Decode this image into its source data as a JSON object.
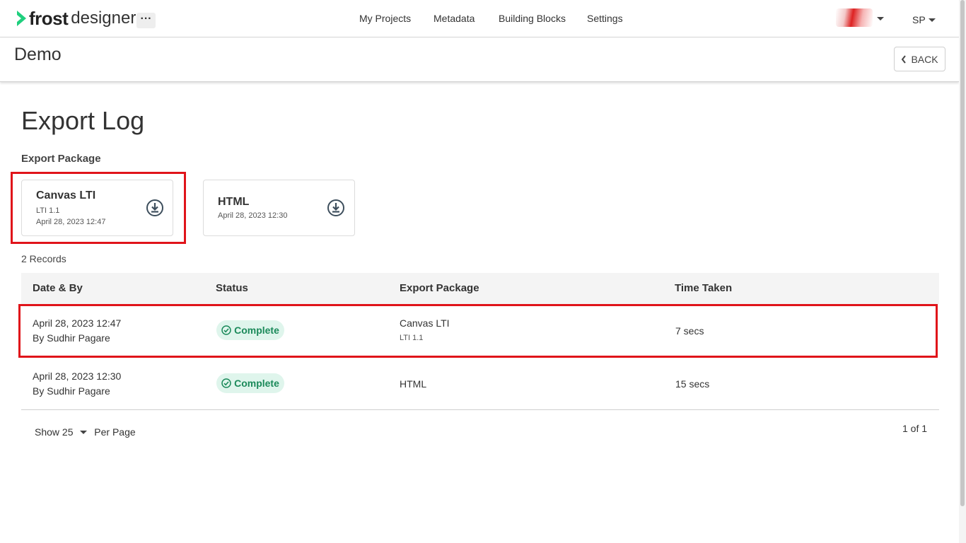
{
  "app": {
    "name_bold": "frost",
    "name_rest": "designer",
    "more_label": "···"
  },
  "nav": {
    "items": [
      "My Projects",
      "Metadata",
      "Building Blocks",
      "Settings"
    ]
  },
  "user": {
    "initials": "SP"
  },
  "project": {
    "title": "Demo",
    "back_label": "BACK"
  },
  "page": {
    "heading": "Export Log",
    "section_label": "Export Package",
    "records_count": "2 Records"
  },
  "packages": [
    {
      "name": "Canvas LTI",
      "version": "LTI 1.1",
      "date": "April 28, 2023 12:47"
    },
    {
      "name": "HTML",
      "date": "April 28, 2023 12:30"
    }
  ],
  "table": {
    "columns": [
      "Date & By",
      "Status",
      "Export Package",
      "Time Taken"
    ],
    "rows": [
      {
        "date": "April 28, 2023 12:47",
        "by": "By Sudhir Pagare",
        "status": "Complete",
        "package": "Canvas LTI",
        "package_sub": "LTI 1.1",
        "time": "7 secs"
      },
      {
        "date": "April 28, 2023 12:30",
        "by": "By Sudhir Pagare",
        "status": "Complete",
        "package": "HTML",
        "time": "15 secs"
      }
    ]
  },
  "pagination": {
    "show_label": "Show 25",
    "per_page_label": "Per Page",
    "page_info": "1 of 1"
  },
  "colors": {
    "accent_green": "#1fcf7e",
    "highlight_red": "#e0141a",
    "status_bg": "#dff5ec",
    "status_text": "#1b8a5a"
  }
}
